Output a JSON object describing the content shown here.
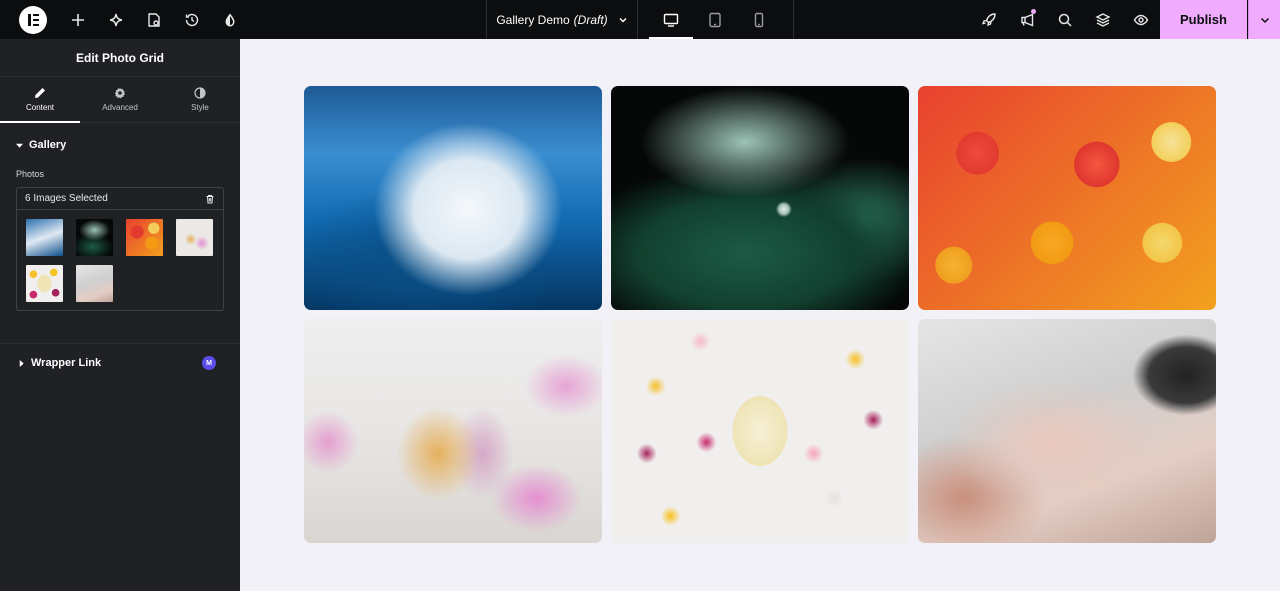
{
  "topbar": {
    "doc_title": "Gallery Demo",
    "doc_status": "(Draft)",
    "publish_label": "Publish",
    "accent_color": "#f0abfc"
  },
  "panel": {
    "title": "Edit Photo Grid",
    "tabs": [
      {
        "label": "Content",
        "icon": "pencil-icon",
        "active": true
      },
      {
        "label": "Advanced",
        "icon": "gear-icon",
        "active": false
      },
      {
        "label": "Style",
        "icon": "half-circle-icon",
        "active": false
      }
    ],
    "gallery": {
      "section_label": "Gallery",
      "photos_label": "Photos",
      "selected_text": "6 Images Selected",
      "thumbnails": [
        "wave",
        "leaf-droplet",
        "citrus-slices",
        "perfume-flowers",
        "flowers-perfume",
        "glass-bottle"
      ]
    },
    "wrapper_link": {
      "label": "Wrapper Link",
      "badge": "M"
    }
  },
  "canvas": {
    "photos": [
      "wave",
      "leaf-droplet",
      "citrus-slices",
      "perfume-flowers",
      "flowers-perfume",
      "glass-bottle"
    ]
  }
}
